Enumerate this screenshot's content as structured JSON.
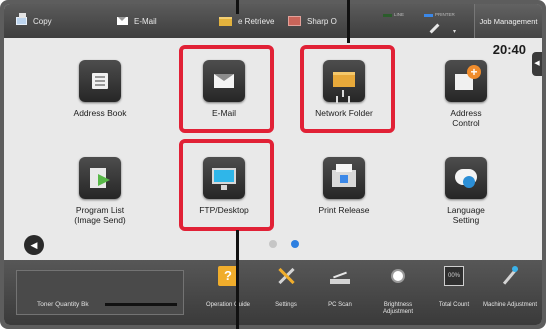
{
  "topbar": {
    "shortcuts": [
      {
        "label": "Copy",
        "icon": "copy-icon"
      },
      {
        "label": "E-Mail",
        "icon": "envelope-icon"
      },
      {
        "label": "e Retrieve",
        "icon": "folder-icon"
      },
      {
        "label": "Sharp O",
        "icon": "sharp-osa-icon"
      }
    ],
    "status": {
      "line_label": "LINE",
      "printer_label": "PRINTER"
    },
    "job_management": "Job Management"
  },
  "clock": "20:40",
  "apps": [
    {
      "label": "Address Book",
      "icon": "address-book-icon",
      "highlighted": false
    },
    {
      "label": "E-Mail",
      "icon": "email-icon",
      "highlighted": true
    },
    {
      "label": "Network Folder",
      "icon": "network-folder-icon",
      "highlighted": true
    },
    {
      "label": "Address Control",
      "icon": "address-control-icon",
      "highlighted": false
    },
    {
      "label": "Program List (Image Send)",
      "icon": "program-list-icon",
      "highlighted": false
    },
    {
      "label": "FTP/Desktop",
      "icon": "monitor-icon",
      "highlighted": true
    },
    {
      "label": "Print Release",
      "icon": "print-release-icon",
      "highlighted": false
    },
    {
      "label": "Language Setting",
      "icon": "language-icon",
      "highlighted": false
    }
  ],
  "pagination": {
    "current": 2,
    "total": 2
  },
  "bottombar": {
    "toner": {
      "label": "Toner Quantity Bk",
      "level": 1.0
    },
    "items": [
      {
        "label": "Operation Guide",
        "icon": "help-icon"
      },
      {
        "label": "Settings",
        "icon": "tools-icon"
      },
      {
        "label": "PC Scan",
        "icon": "scanner-icon"
      },
      {
        "label": "Brightness Adjustment",
        "icon": "brightness-icon"
      },
      {
        "label": "Total Count",
        "icon": "counter-icon"
      },
      {
        "label": "Machine Adjustment",
        "icon": "machine-adjust-icon"
      }
    ]
  },
  "colors": {
    "highlight": "#e12136",
    "accent": "#2d7fe0"
  }
}
